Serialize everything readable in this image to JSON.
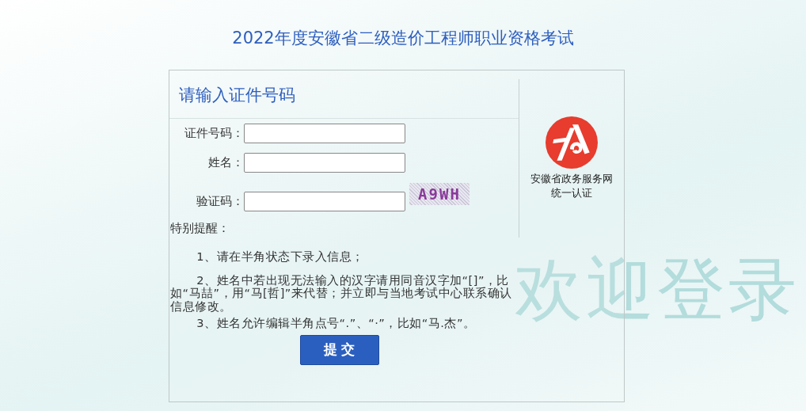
{
  "page_title": "2022年度安徽省二级造价工程师职业资格考试",
  "watermark": "欢迎登录",
  "form": {
    "heading": "请输入证件号码",
    "fields": [
      {
        "label": "证件号码：",
        "kind": "text"
      },
      {
        "label": "姓名：",
        "kind": "text"
      },
      {
        "label": "验证码：",
        "kind": "captcha",
        "captcha": "A9WH"
      }
    ],
    "notice_title": "特别提醒：",
    "notes": [
      "1、请在半角状态下录入信息；",
      "2、姓名中若出现无法输入的汉字请用同音汉字加“[]”，比如“马喆”，用“马[哲]”来代替；并立即与当地考试中心联系确认信息修改。",
      "3、姓名允许编辑半角点号“.”、“·”，比如“马.杰”。"
    ],
    "submit": "提 交"
  },
  "sso": {
    "lines": [
      "安徽省政务服务网",
      "统一认证"
    ]
  }
}
